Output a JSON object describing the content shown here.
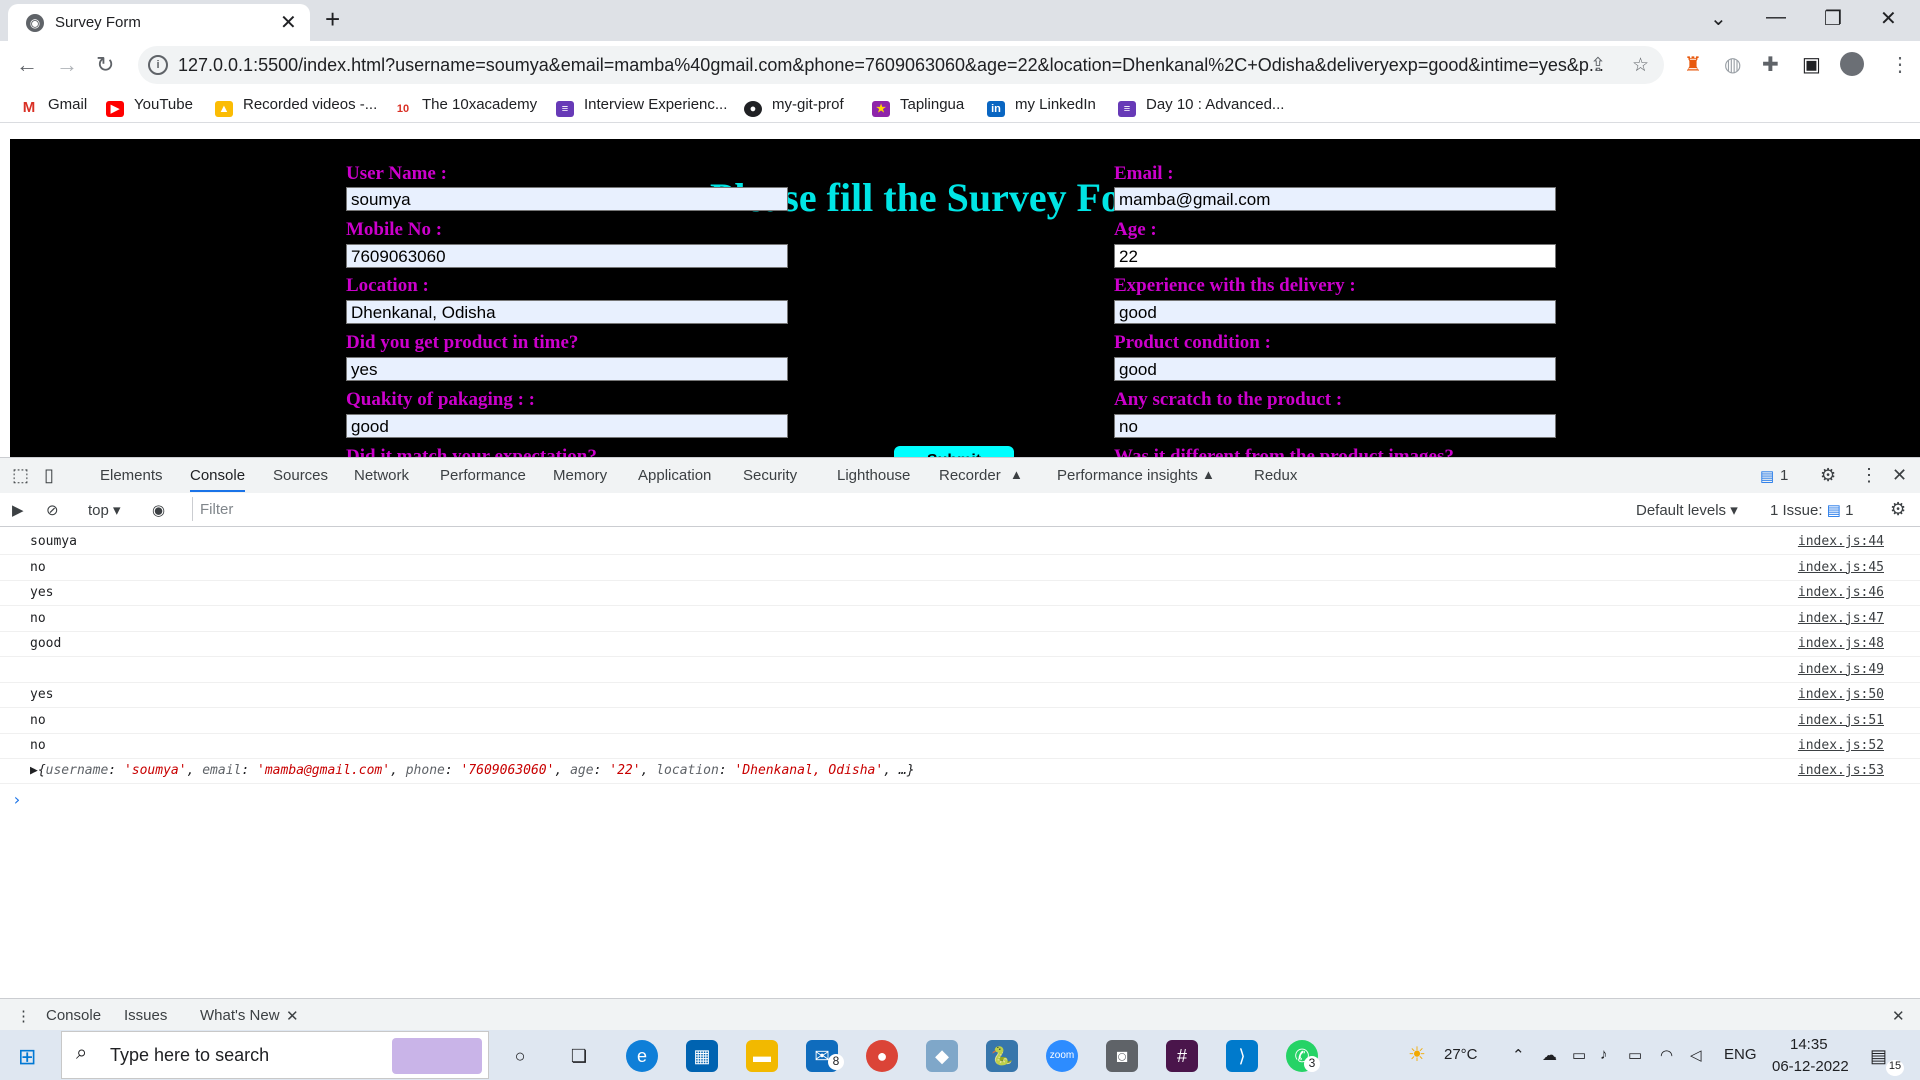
{
  "browser": {
    "tab_title": "Survey Form",
    "url": "127.0.0.1:5500/index.html?username=soumya&email=mamba%40gmail.com&phone=7609063060&age=22&location=Dhenkanal%2C+Odisha&deliveryexp=good&intime=yes&p...",
    "bookmarks": [
      "Gmail",
      "YouTube",
      "Recorded videos -...",
      "The 10xacademy",
      "Interview Experienc...",
      "my-git-prof",
      "Taplingua",
      "my LinkedIn",
      "Day 10 : Advanced..."
    ]
  },
  "page": {
    "title": "Please fill the Survey Form",
    "fields": {
      "username": {
        "label": "User Name :",
        "value": "soumya"
      },
      "email": {
        "label": "Email :",
        "value": "mamba@gmail.com"
      },
      "mobile": {
        "label": "Mobile No :",
        "value": "7609063060"
      },
      "age": {
        "label": "Age :",
        "value": "22"
      },
      "location": {
        "label": "Location :",
        "value": "Dhenkanal, Odisha"
      },
      "delivery": {
        "label": "Experience with ths delivery :",
        "value": "good"
      },
      "intime": {
        "label": "Did you get product in time?",
        "value": "yes"
      },
      "condition": {
        "label": "Product condition :",
        "value": "good"
      },
      "packaging": {
        "label": "Quakity of pakaging : :",
        "value": "good"
      },
      "scratch": {
        "label": "Any scratch to the product :",
        "value": "no"
      },
      "expectation": {
        "label": "Did it match your expectation?"
      },
      "different": {
        "label": "Was it different from the product images?"
      }
    },
    "submit_label": "Submit"
  },
  "devtools": {
    "tabs": [
      "Elements",
      "Console",
      "Sources",
      "Network",
      "Performance",
      "Memory",
      "Application",
      "Security",
      "Lighthouse",
      "Recorder",
      "Performance insights",
      "Redux"
    ],
    "issues_badge": "1",
    "context": "top",
    "filter_placeholder": "Filter",
    "levels": "Default levels",
    "issues_label": "1 Issue:",
    "issues_count": "1",
    "console_rows": [
      {
        "msg": "soumya",
        "src": "index.js:44"
      },
      {
        "msg": "no",
        "src": "index.js:45"
      },
      {
        "msg": "yes",
        "src": "index.js:46"
      },
      {
        "msg": "no",
        "src": "index.js:47"
      },
      {
        "msg": "good",
        "src": "index.js:48"
      },
      {
        "msg": "",
        "src": "index.js:49"
      },
      {
        "msg": "yes",
        "src": "index.js:50"
      },
      {
        "msg": "no",
        "src": "index.js:51"
      },
      {
        "msg": "no",
        "src": "index.js:52"
      }
    ],
    "object_row": {
      "src": "index.js:53",
      "parts": [
        {
          "k": "username",
          "v": "'soumya'"
        },
        {
          "k": "email",
          "v": "'mamba@gmail.com'"
        },
        {
          "k": "phone",
          "v": "'7609063060'"
        },
        {
          "k": "age",
          "v": "'22'"
        },
        {
          "k": "location",
          "v": "'Dhenkanal, Odisha'"
        }
      ],
      "tail": ", …}"
    },
    "drawer_tabs": [
      "Console",
      "Issues",
      "What's New"
    ]
  },
  "taskbar": {
    "search_placeholder": "Type here to search",
    "mail_badge": "8",
    "whatsapp_badge": "3",
    "weather": "27°C",
    "lang": "ENG",
    "time": "14:35",
    "date": "06-12-2022",
    "notif": "15"
  },
  "colors": {
    "page_bg": "#000000",
    "title": "#00e5e5",
    "labels": "#cc00cc",
    "submit": "#00ffff",
    "accent": "#1a73e8"
  }
}
